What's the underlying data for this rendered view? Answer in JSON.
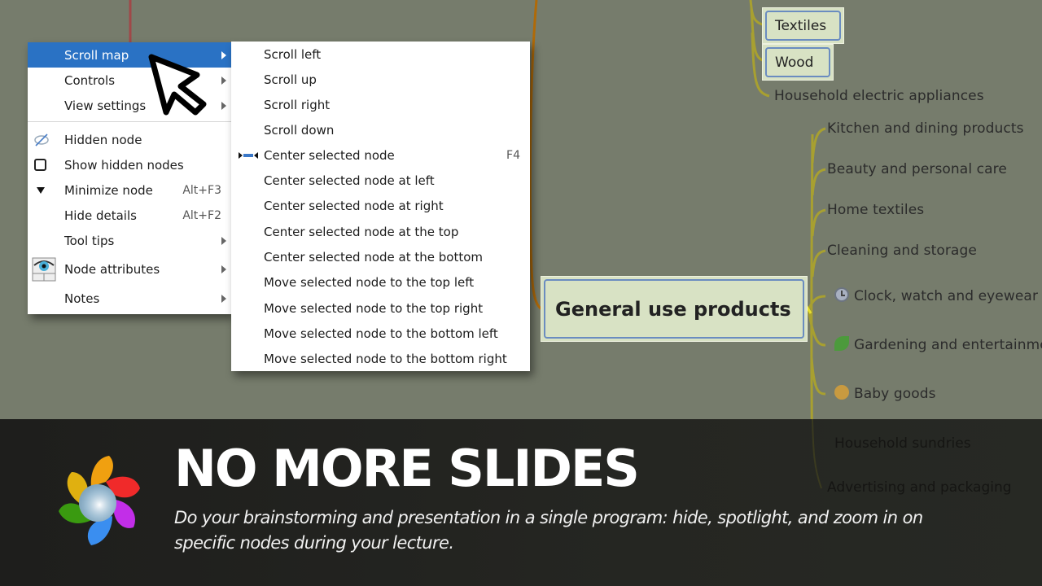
{
  "context_menu": {
    "items": [
      {
        "label": "Scroll map",
        "has_submenu": true,
        "active": true
      },
      {
        "label": "Controls",
        "has_submenu": true
      },
      {
        "label": "View settings",
        "has_submenu": true
      },
      {
        "label": "Hidden node",
        "icon": "hidden-eye-icon"
      },
      {
        "label": "Show hidden nodes",
        "icon": "checkbox-icon",
        "checked": false
      },
      {
        "label": "Minimize node",
        "icon": "triangle-down-icon",
        "shortcut": "Alt+F3"
      },
      {
        "label": "Hide details",
        "shortcut": "Alt+F2"
      },
      {
        "label": "Tool tips",
        "has_submenu": true
      },
      {
        "label": "Node attributes",
        "icon": "eye-table-icon",
        "has_submenu": true
      },
      {
        "label": "Notes",
        "has_submenu": true
      }
    ]
  },
  "submenu": {
    "items": [
      {
        "label": "Scroll left"
      },
      {
        "label": "Scroll up"
      },
      {
        "label": "Scroll right"
      },
      {
        "label": "Scroll down"
      },
      {
        "label": "Center selected node",
        "icon": "center-node-icon",
        "shortcut": "F4"
      },
      {
        "label": "Center selected node at left"
      },
      {
        "label": "Center selected node at right"
      },
      {
        "label": "Center selected node at the top"
      },
      {
        "label": "Center selected node at the bottom"
      },
      {
        "label": "Move selected node to the top left"
      },
      {
        "label": "Move selected node to the top right"
      },
      {
        "label": "Move selected node to the bottom left"
      },
      {
        "label": "Move selected node to the bottom right"
      }
    ]
  },
  "mindmap": {
    "boxed_nodes": [
      "Textiles",
      "Wood"
    ],
    "household_appliances": "Household electric appliances",
    "central_node": "General use products",
    "children": [
      {
        "label": "Kitchen and dining products"
      },
      {
        "label": "Beauty and personal care"
      },
      {
        "label": "Home textiles"
      },
      {
        "label": "Cleaning and storage"
      },
      {
        "label": "Clock, watch and eyewear",
        "icon": "clock-icon"
      },
      {
        "label": "Gardening and entertainment",
        "icon": "leaf-icon"
      },
      {
        "label": "Baby goods",
        "icon": "baby-icon"
      },
      {
        "label": "Household sundries"
      },
      {
        "label": "Advertising and packaging"
      }
    ]
  },
  "banner": {
    "title": "NO MORE SLIDES",
    "description": "Do your brainstorming and presentation in a single program: hide, spotlight, and zoom in on specific nodes during your lecture."
  },
  "colors": {
    "canvas": "#767c6c",
    "menu_highlight": "#2a72c4",
    "node_fill": "#d8e2c4",
    "node_border": "#6a8cc0",
    "branch_yellow": "#a8a030",
    "branch_orange": "#b06a08",
    "branch_red": "#a04848"
  }
}
